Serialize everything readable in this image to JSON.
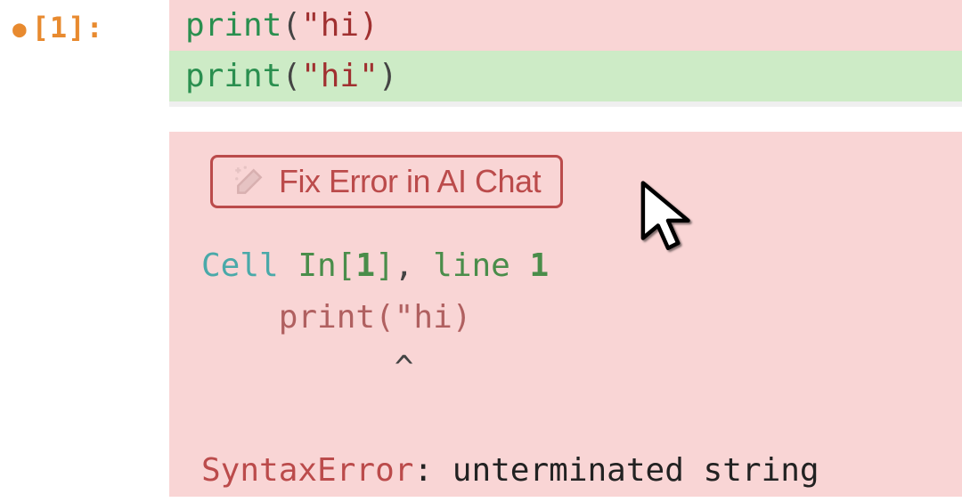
{
  "cell": {
    "prompt": "[1]:",
    "code_removed_func": "print",
    "code_removed_open": "(",
    "code_removed_str": "\"hi)",
    "code_added_func": "print",
    "code_added_open": "(",
    "code_added_str": "\"hi\"",
    "code_added_close": ")"
  },
  "fix_button": {
    "label": "Fix Error in AI Chat"
  },
  "traceback": {
    "cell_word": "Cell ",
    "in_word": "In",
    "brack_open": "[",
    "idx": "1",
    "brack_close": "]",
    "comma": ", ",
    "line_word": "line ",
    "line_no": "1",
    "code_indent": "    ",
    "code_text": "print(\"hi)",
    "caret_indent": "          ",
    "caret": "^",
    "error_name": "SyntaxError",
    "colon_sep": ": ",
    "error_msg": "unterminated string"
  }
}
